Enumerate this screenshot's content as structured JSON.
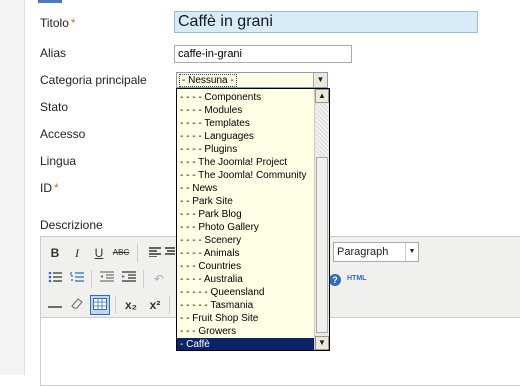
{
  "form": {
    "title_label": "Titolo",
    "title_value": "Caffè in grani",
    "alias_label": "Alias",
    "alias_value": "caffe-in-grani",
    "category_label": "Categoria principale",
    "category_value": "- Nessuna -",
    "state_label": "Stato",
    "access_label": "Accesso",
    "language_label": "Lingua",
    "id_label": "ID",
    "description_label": "Descrizione",
    "required_mark": "*"
  },
  "category_options": [
    "- - - - Components",
    "- - - - Modules",
    "- - - - Templates",
    "- - - - Languages",
    "- - - - Plugins",
    "- - - The Joomla! Project",
    "- - - The Joomla! Community",
    "- - News",
    "- - Park Site",
    "- - - Park Blog",
    "- - - Photo Gallery",
    "- - - - Scenery",
    "- - - - Animals",
    "- - - Countries",
    "- - - - Australia",
    "- - - - - Queensland",
    "- - - - - Tasmania",
    "- - Fruit Shop Site",
    "- - - Growers",
    "- Caffè"
  ],
  "selected_option_index": 19,
  "editor": {
    "format_select": "Paragraph",
    "bold": "B",
    "italic": "I",
    "underline": "U",
    "strike": "ABC",
    "subscript": "x₂",
    "superscript": "x²",
    "html_button": "HTML",
    "help_button": "?"
  },
  "icons": {
    "scroll_up": "scroll-up-arrow-icon",
    "scroll_down": "scroll-down-arrow-icon"
  },
  "colors": {
    "title_bg": "#d8ebf8",
    "dropdown_bg": "#ffffe6",
    "selection": "#0a246a",
    "required": "#e46a0b"
  }
}
